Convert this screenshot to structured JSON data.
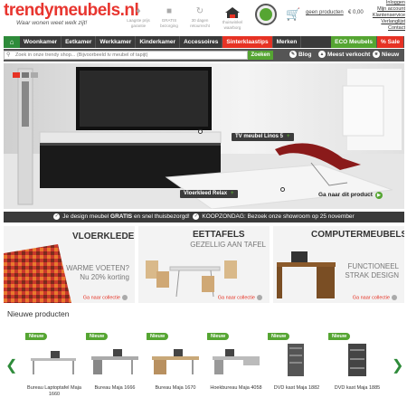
{
  "header": {
    "logo_text": "trendymeubels.nl",
    "tagline": "Waar wonen weet welk zijt!",
    "usps": [
      {
        "icon": "price-tag-icon",
        "label": "Laagste prijs garantie"
      },
      {
        "icon": "truck-icon",
        "label": "GRATIS bezorging"
      },
      {
        "icon": "return-icon",
        "label": "30 dagen retourrecht"
      },
      {
        "icon": "thuiswinkel-icon",
        "label": "thuiswinkel waarborg"
      },
      {
        "icon": "webwinkelkeur-icon",
        "label": "webwinkelkeur"
      }
    ],
    "cart": {
      "link": "geen producten",
      "total": "€ 0,00"
    },
    "links": [
      "Inloggen",
      "Mijn account",
      "Klantenservice",
      "Verlanglijst",
      "Contact"
    ]
  },
  "nav": {
    "items": [
      "Woonkamer",
      "Eetkamer",
      "Werkkamer",
      "Kinderkamer",
      "Accessoires",
      "Sinterklaastips",
      "Merken"
    ],
    "eco": "ECO Meubels",
    "sale": "% Sale"
  },
  "search": {
    "placeholder": "Zoek in onze trendy shop... (Bijvoorbeeld tv meubel of tapijt)",
    "button": "Zoeken"
  },
  "quicklinks": {
    "blog": "Blog",
    "meest": "Meest verkocht",
    "nieuw": "Nieuw"
  },
  "hero": {
    "label1": "TV meubel Linos 5",
    "label2": "Vloerkleed Relax",
    "cta": "Ga naar dit product"
  },
  "promo": {
    "part1": "Je design meubel",
    "bold": "GRATIS",
    "part2": "en snel thuisbezorgd!",
    "part3": "KOOPZONDAG: Bezoek onze showroom op 25 november"
  },
  "tiles": [
    {
      "heading": "VLOERKLEDEN",
      "sub1": "WARME VOETEN?",
      "sub2": "Nu 20% korting",
      "link": "Ga naar collectie"
    },
    {
      "heading": "EETTAFELS",
      "sub1": "GEZELLIG AAN TAFEL",
      "link": "Ga naar collectie"
    },
    {
      "heading": "COMPUTERMEUBELS",
      "sub1": "FUNCTIONEEL",
      "sub2": "STRAK DESIGN",
      "link": "Ga naar collectie"
    }
  ],
  "new_products": {
    "title": "Nieuwe producten",
    "badge": "Nieuw",
    "items": [
      {
        "name": "Bureau Laptoptafel Maja 1660"
      },
      {
        "name": "Bureau Maja 1666"
      },
      {
        "name": "Bureau Maja 1670"
      },
      {
        "name": "Hoekbureau Maja 4058"
      },
      {
        "name": "DVD kast Maja 1882"
      },
      {
        "name": "DVD kast Maja 1885"
      }
    ]
  },
  "colors": {
    "green": "#55a532",
    "red": "#e63224",
    "dark": "#3a3a3a"
  }
}
